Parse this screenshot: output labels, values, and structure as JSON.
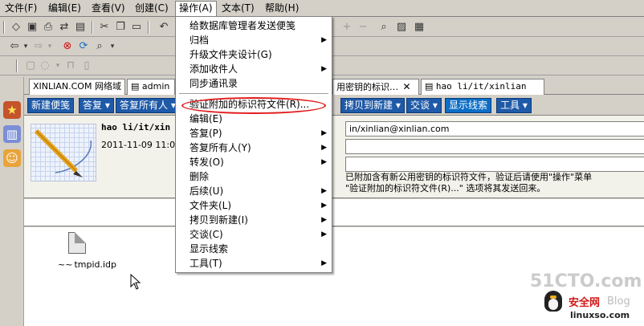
{
  "menubar": {
    "items": [
      {
        "label": "文件(F)"
      },
      {
        "label": "编辑(E)"
      },
      {
        "label": "查看(V)"
      },
      {
        "label": "创建(C)"
      },
      {
        "label": "操作(A)"
      },
      {
        "label": "文本(T)"
      },
      {
        "label": "帮助(H)"
      }
    ]
  },
  "tabs": [
    {
      "label": "XINLIAN.COM 网络域"
    },
    {
      "label": "admin"
    },
    {
      "label": "用密钥的标识…"
    },
    {
      "label": "hao li/it/xinlian"
    }
  ],
  "tab_close_glyph": "✕",
  "actionbar": {
    "buttons": [
      {
        "label": "新建便笺"
      },
      {
        "label": "答复 ▾"
      },
      {
        "label": "答复所有人 ▾"
      },
      {
        "label": "拷贝到新建 ▾"
      },
      {
        "label": "交谈 ▾"
      },
      {
        "label": "显示线索"
      },
      {
        "label": "工具 ▾"
      }
    ]
  },
  "header": {
    "sender": "hao li/it/xin",
    "date": "2011-11-09 11:0",
    "to_field": "in/xinlian@xinlian.com",
    "note_line1": "已附加含有新公用密钥的标识符文件，验证后请使用\"操作\"菜单",
    "note_line2": "\"验证附加的标识符文件(R)...\" 选项将其发送回来。"
  },
  "attachment": {
    "filename": "tmpid.idp"
  },
  "dropdown": {
    "items": [
      {
        "label": "给数据库管理者发送便笺",
        "submenu": false
      },
      {
        "label": "归档",
        "submenu": true
      },
      {
        "label": "升级文件夹设计(G)",
        "submenu": false
      },
      {
        "label": "添加收件人",
        "submenu": true
      },
      {
        "label": "同步通讯录",
        "submenu": false
      },
      {
        "label": "验证附加的标识符文件(R)...",
        "submenu": false
      },
      {
        "label": "编辑(E)",
        "submenu": false
      },
      {
        "label": "答复(P)",
        "submenu": true
      },
      {
        "label": "答复所有人(Y)",
        "submenu": true
      },
      {
        "label": "转发(O)",
        "submenu": true
      },
      {
        "label": "删除",
        "submenu": false
      },
      {
        "label": "后续(U)",
        "submenu": true
      },
      {
        "label": "文件夹(L)",
        "submenu": true
      },
      {
        "label": "拷贝到新建(I)",
        "submenu": true
      },
      {
        "label": "交谈(C)",
        "submenu": true
      },
      {
        "label": "显示线索",
        "submenu": false
      },
      {
        "label": "工具(T)",
        "submenu": true
      }
    ],
    "submenu_arrow": "▶"
  },
  "watermark": {
    "site": "51CTO.com",
    "brand": "安全网",
    "blog": "Blog",
    "domain": "linuxso.com"
  },
  "colors": {
    "highlight_oval": "#e21b1b",
    "action_button": "#1f5aa8"
  }
}
